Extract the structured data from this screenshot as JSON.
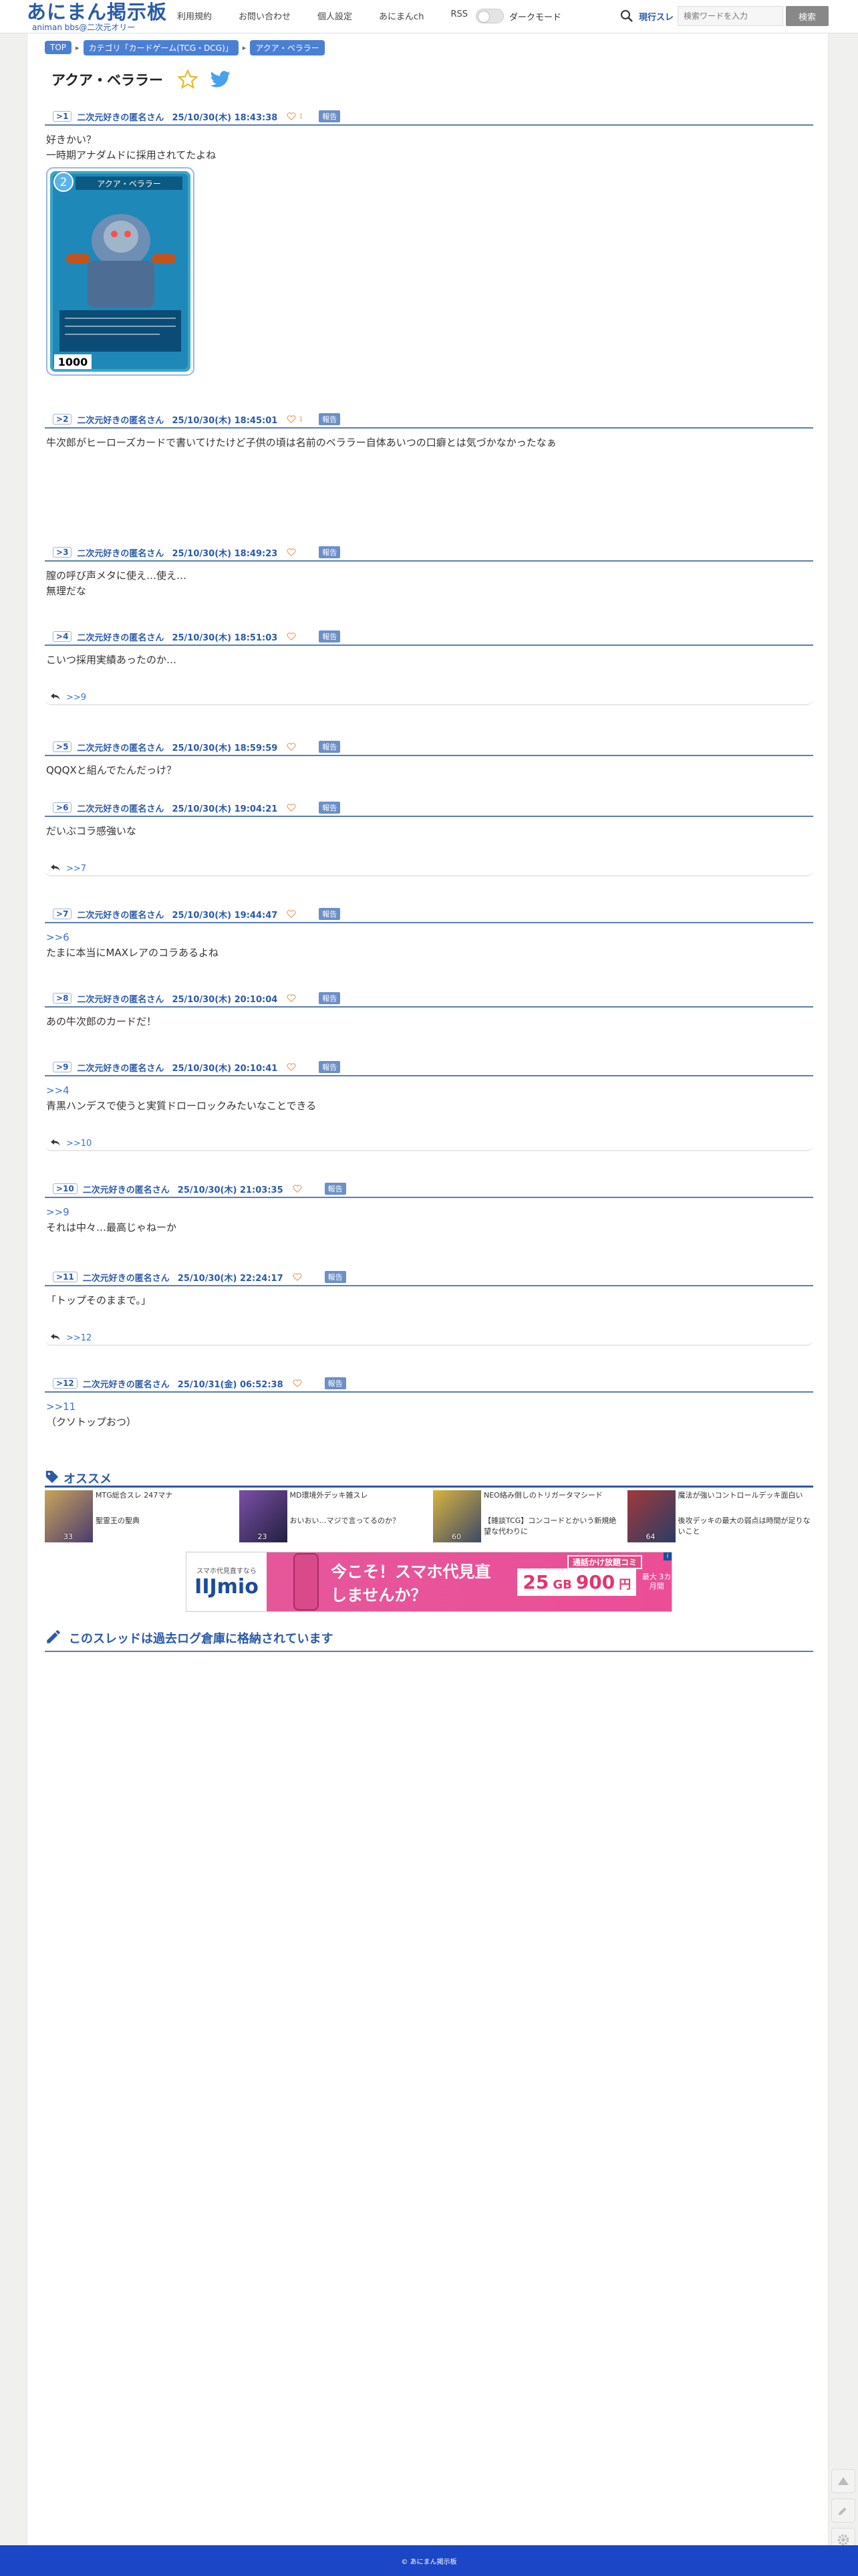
{
  "header": {
    "logo_main": "あにまん掲示板",
    "logo_sub": "animan bbs@二次元オリー",
    "nav": [
      "利用規約",
      "お問い合わせ",
      "個人設定",
      "あにまんch",
      "RSS"
    ],
    "dark_mode_label": "ダークモード",
    "search_scope": "現行スレ",
    "search_placeholder": "検索ワードを入力",
    "search_button": "検索"
  },
  "breadcrumb": [
    "TOP",
    "カテゴリ「カードゲーム(TCG・DCG)」",
    "アクア・ベララー"
  ],
  "thread_title": "アクア・ベララー",
  "posts": [
    {
      "num": "1",
      "name": "二次元好きの匿名さん",
      "date": "25/10/30(木) 18:43:38",
      "likes": "1",
      "report": "報告",
      "anchor": "",
      "lines": [
        "好きかい？",
        "一時期アナダムドに採用されてたよね"
      ],
      "reply": "",
      "card_cost": "2",
      "card_name": "アクア・ベララー",
      "card_power": "1000"
    },
    {
      "num": "2",
      "name": "二次元好きの匿名さん",
      "date": "25/10/30(木) 18:45:01",
      "likes": "1",
      "report": "報告",
      "anchor": "",
      "lines": [
        "牛次郎がヒーローズカードで書いてけたけど子供の頃は名前のベララー自体あいつの口癖とは気づかなかったなぁ"
      ],
      "reply": ""
    },
    {
      "num": "3",
      "name": "二次元好きの匿名さん",
      "date": "25/10/30(木) 18:49:23",
      "likes": "",
      "report": "報告",
      "anchor": "",
      "lines": [
        "膣の呼び声メタに使え…使え…",
        "無理だな"
      ],
      "reply": ""
    },
    {
      "num": "4",
      "name": "二次元好きの匿名さん",
      "date": "25/10/30(木) 18:51:03",
      "likes": "",
      "report": "報告",
      "anchor": "",
      "lines": [
        "こいつ採用実績あったのか…"
      ],
      "reply": ">>9"
    },
    {
      "num": "5",
      "name": "二次元好きの匿名さん",
      "date": "25/10/30(木) 18:59:59",
      "likes": "",
      "report": "報告",
      "anchor": "",
      "lines": [
        "QQQXと組んでたんだっけ？"
      ],
      "reply": ""
    },
    {
      "num": "6",
      "name": "二次元好きの匿名さん",
      "date": "25/10/30(木) 19:04:21",
      "likes": "",
      "report": "報告",
      "anchor": "",
      "lines": [
        "だいぶコラ感強いな"
      ],
      "reply": ">>7"
    },
    {
      "num": "7",
      "name": "二次元好きの匿名さん",
      "date": "25/10/30(木) 19:44:47",
      "likes": "",
      "report": "報告",
      "anchor": ">>6",
      "lines": [
        "たまに本当にMAXレアのコラあるよね"
      ],
      "reply": ""
    },
    {
      "num": "8",
      "name": "二次元好きの匿名さん",
      "date": "25/10/30(木) 20:10:04",
      "likes": "",
      "report": "報告",
      "anchor": "",
      "lines": [
        "あの牛次郎のカードだ！"
      ],
      "reply": ""
    },
    {
      "num": "9",
      "name": "二次元好きの匿名さん",
      "date": "25/10/30(木) 20:10:41",
      "likes": "",
      "report": "報告",
      "anchor": ">>4",
      "lines": [
        "青黒ハンデスで使うと実質ドローロックみたいなことできる"
      ],
      "reply": ">>10"
    },
    {
      "num": "10",
      "name": "二次元好きの匿名さん",
      "date": "25/10/30(木) 21:03:35",
      "likes": "",
      "report": "報告",
      "anchor": ">>9",
      "lines": [
        "それは中々…最高じゃねーか"
      ],
      "reply": ""
    },
    {
      "num": "11",
      "name": "二次元好きの匿名さん",
      "date": "25/10/30(木) 22:24:17",
      "likes": "",
      "report": "報告",
      "anchor": "",
      "lines": [
        "「トップそのままで。」"
      ],
      "reply": ">>12"
    },
    {
      "num": "12",
      "name": "二次元好きの匿名さん",
      "date": "25/10/31(金) 06:52:38",
      "likes": "",
      "report": "報告",
      "anchor": ">>11",
      "lines": [
        "（クソトップおつ）"
      ],
      "reply": ""
    }
  ],
  "recommend": {
    "title": "オススメ",
    "items": [
      {
        "top": "MTG総合スレ 247マナ",
        "bottom": "聖霊王の聖典",
        "count": "33"
      },
      {
        "top": "MD環境外デッキ雑スレ",
        "bottom": "おいおい…マジで言ってるのか？",
        "count": "23"
      },
      {
        "top": "NEO絡み倒しのトリガータマシード",
        "bottom": "【雑談TCG】コンコードとかいう新規絶望な代わりに",
        "count": "60"
      },
      {
        "top": "魔法が強いコントロールデッキ面白い",
        "bottom": "後攻デッキの最大の弱点は時間が足りないこと",
        "count": "64"
      }
    ]
  },
  "ad": {
    "left_top": "スマホ代見直すなら",
    "logo": "IIJmio",
    "copy": "今こそ！スマホ代見直しませんか？",
    "label": "通話かけ放題コミ",
    "price_gb": "25",
    "price_unit": "GB",
    "price": "900",
    "price_yen": "円",
    "side": "最大\n3カ月間",
    "close": "i"
  },
  "archive_title": "このスレッドは過去ログ倉庫に格納されています",
  "footer": "© あにまん掲示板",
  "colors": {
    "accent": "#2a5aa8",
    "footer": "#1b46c6",
    "report": "#6c8fc8",
    "like": "#e9a36a"
  }
}
